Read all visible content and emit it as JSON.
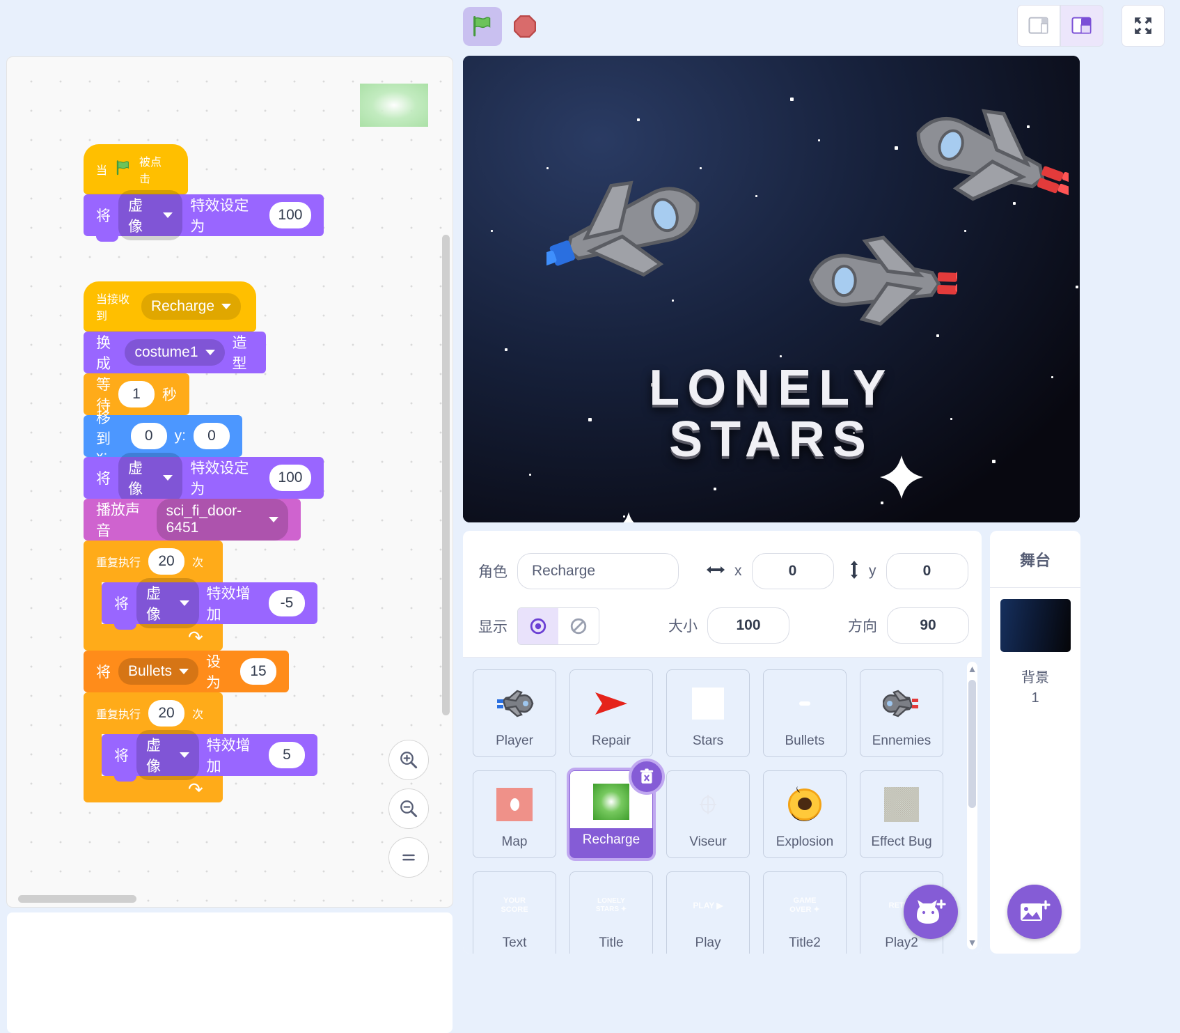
{
  "toolbar": {
    "green_flag": "green-flag-icon",
    "stop": "stop-icon",
    "layout_small": "small-stage-layout-icon",
    "layout_large": "large-stage-layout-icon",
    "fullscreen": "fullscreen-icon"
  },
  "code": {
    "scripts": [
      {
        "id": "script-when-flag-clicked",
        "blocks": [
          {
            "type": "hat",
            "category": "event",
            "parts": [
              {
                "kind": "label",
                "text": "当"
              },
              {
                "kind": "icon",
                "name": "green-flag-icon"
              },
              {
                "kind": "label",
                "text": "被点击"
              }
            ]
          },
          {
            "type": "stack",
            "category": "looks",
            "parts": [
              {
                "kind": "label",
                "text": "将"
              },
              {
                "kind": "dropdown",
                "text": "虚像"
              },
              {
                "kind": "label",
                "text": "特效设定为"
              },
              {
                "kind": "input",
                "text": "100"
              }
            ]
          }
        ]
      },
      {
        "id": "script-when-recharge-received",
        "blocks": [
          {
            "type": "hat",
            "category": "event",
            "parts": [
              {
                "kind": "label",
                "text": "当接收到"
              },
              {
                "kind": "dropdown",
                "text": "Recharge"
              }
            ]
          },
          {
            "type": "stack",
            "category": "looks",
            "parts": [
              {
                "kind": "label",
                "text": "换成"
              },
              {
                "kind": "dropdown",
                "text": "costume1"
              },
              {
                "kind": "label",
                "text": "造型"
              }
            ]
          },
          {
            "type": "stack",
            "category": "control",
            "parts": [
              {
                "kind": "label",
                "text": "等待"
              },
              {
                "kind": "input",
                "text": "1"
              },
              {
                "kind": "label",
                "text": "秒"
              }
            ]
          },
          {
            "type": "stack",
            "category": "motion",
            "parts": [
              {
                "kind": "label",
                "text": "移到 x:"
              },
              {
                "kind": "input",
                "text": "0"
              },
              {
                "kind": "label",
                "text": "y:"
              },
              {
                "kind": "input",
                "text": "0"
              }
            ]
          },
          {
            "type": "stack",
            "category": "looks",
            "parts": [
              {
                "kind": "label",
                "text": "将"
              },
              {
                "kind": "dropdown",
                "text": "虚像"
              },
              {
                "kind": "label",
                "text": "特效设定为"
              },
              {
                "kind": "input",
                "text": "100"
              }
            ]
          },
          {
            "type": "stack",
            "category": "sound",
            "parts": [
              {
                "kind": "label",
                "text": "播放声音"
              },
              {
                "kind": "dropdown",
                "text": "sci_fi_door-6451"
              }
            ]
          },
          {
            "type": "c-block",
            "category": "control",
            "header": [
              {
                "kind": "label",
                "text": "重复执行"
              },
              {
                "kind": "input",
                "text": "20"
              },
              {
                "kind": "label",
                "text": "次"
              }
            ],
            "body": [
              {
                "type": "stack",
                "category": "looks",
                "parts": [
                  {
                    "kind": "label",
                    "text": "将"
                  },
                  {
                    "kind": "dropdown",
                    "text": "虚像"
                  },
                  {
                    "kind": "label",
                    "text": "特效增加"
                  },
                  {
                    "kind": "input",
                    "text": "-5"
                  }
                ]
              }
            ]
          },
          {
            "type": "stack",
            "category": "variable",
            "parts": [
              {
                "kind": "label",
                "text": "将"
              },
              {
                "kind": "dropdown",
                "text": "Bullets"
              },
              {
                "kind": "label",
                "text": "设为"
              },
              {
                "kind": "input",
                "text": "15"
              }
            ]
          },
          {
            "type": "c-block",
            "category": "control",
            "header": [
              {
                "kind": "label",
                "text": "重复执行"
              },
              {
                "kind": "input",
                "text": "20"
              },
              {
                "kind": "label",
                "text": "次"
              }
            ],
            "body": [
              {
                "type": "stack",
                "category": "looks",
                "parts": [
                  {
                    "kind": "label",
                    "text": "将"
                  },
                  {
                    "kind": "dropdown",
                    "text": "虚像"
                  },
                  {
                    "kind": "label",
                    "text": "特效增加"
                  },
                  {
                    "kind": "input",
                    "text": "5"
                  }
                ]
              }
            ]
          }
        ]
      }
    ],
    "zoom_in": "zoom-in-icon",
    "zoom_out": "zoom-out-icon",
    "zoom_reset": "zoom-reset-icon"
  },
  "stage": {
    "title_line1": "LONELY",
    "title_line2": "STARS"
  },
  "sprite_info": {
    "name_label": "角色",
    "name_value": "Recharge",
    "x_label": "x",
    "x_value": "0",
    "y_label": "y",
    "y_value": "0",
    "show_label": "显示",
    "show_on_icon": "eye-visible-icon",
    "show_off_icon": "eye-hidden-icon",
    "size_label": "大小",
    "size_value": "100",
    "direction_label": "方向",
    "direction_value": "90",
    "x_arrow_icon": "horizontal-arrow-icon",
    "y_arrow_icon": "vertical-arrow-icon"
  },
  "sprites": [
    {
      "name": "Player",
      "thumb": "player-ship-thumb",
      "selected": false
    },
    {
      "name": "Repair",
      "thumb": "red-arrow-thumb",
      "selected": false
    },
    {
      "name": "Stars",
      "thumb": "white-square-thumb",
      "selected": false
    },
    {
      "name": "Bullets",
      "thumb": "bullet-dash-thumb",
      "selected": false
    },
    {
      "name": "Ennemies",
      "thumb": "enemy-ship-thumb",
      "selected": false
    },
    {
      "name": "Map",
      "thumb": "pink-map-thumb",
      "selected": false
    },
    {
      "name": "Recharge",
      "thumb": "green-glow-thumb",
      "selected": true
    },
    {
      "name": "Viseur",
      "thumb": "crosshair-thumb",
      "selected": false
    },
    {
      "name": "Explosion",
      "thumb": "explosion-thumb",
      "selected": false
    },
    {
      "name": "Effect Bug",
      "thumb": "noise-thumb",
      "selected": false
    },
    {
      "name": "Text",
      "thumb": "your-score-thumb",
      "selected": false
    },
    {
      "name": "Title",
      "thumb": "lonely-stars-thumb",
      "selected": false
    },
    {
      "name": "Play",
      "thumb": "play-thumb",
      "selected": false
    },
    {
      "name": "Title2",
      "thumb": "game-over-thumb",
      "selected": false
    },
    {
      "name": "Play2",
      "thumb": "retry-thumb",
      "selected": false
    }
  ],
  "sprite_delete_badge": "delete-trash-icon",
  "add_sprite_button": "add-sprite-cat-icon",
  "stage_selector": {
    "header": "舞台",
    "backdrop_label": "背景",
    "backdrop_count": "1",
    "add_backdrop_button": "add-backdrop-image-icon"
  },
  "colors": {
    "looks": "#9966ff",
    "motion": "#4c97ff",
    "sound": "#cf63cf",
    "control": "#ffab19",
    "event": "#ffbf00",
    "variable": "#ff8c1a",
    "accent_purple": "#855cd6",
    "page_bg": "#e8f0fc"
  }
}
